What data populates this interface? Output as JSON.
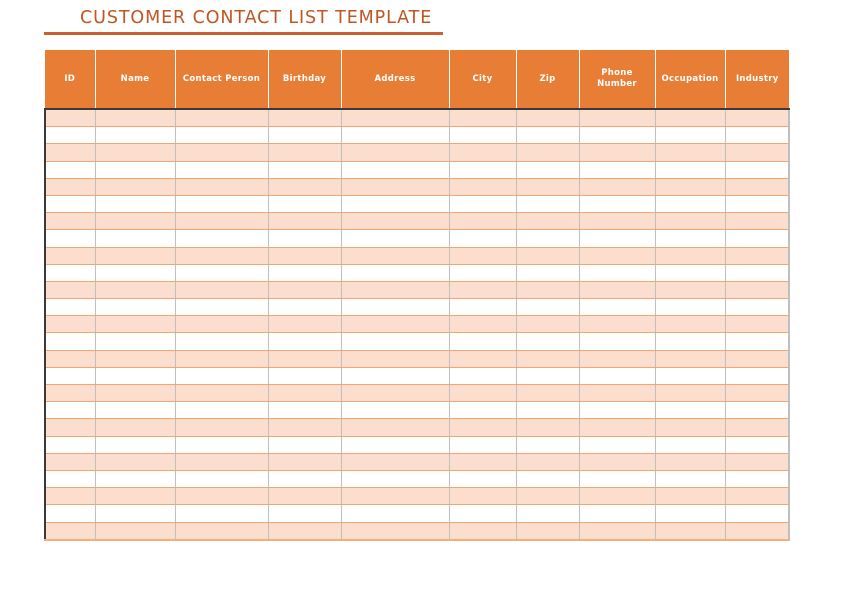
{
  "document": {
    "title": "CUSTOMER CONTACT LIST TEMPLATE"
  },
  "colors": {
    "title_text": "#C1551F",
    "title_rule": "#C86030",
    "header_background": "#E87D35",
    "header_text": "#FFFFFF",
    "row_stripe": "#FBDECE",
    "row_alternate": "#FFFFFF",
    "row_border": "#F0A673",
    "column_border": "#BFBFBF",
    "outer_border": "#3A3A3A",
    "page_background": "#FFFFFF"
  },
  "table": {
    "columns": [
      {
        "key": "id",
        "label": "ID"
      },
      {
        "key": "name",
        "label": "Name"
      },
      {
        "key": "contact",
        "label": "Contact Person"
      },
      {
        "key": "birthday",
        "label": "Birthday"
      },
      {
        "key": "address",
        "label": "Address"
      },
      {
        "key": "city",
        "label": "City"
      },
      {
        "key": "zip",
        "label": "Zip"
      },
      {
        "key": "phone",
        "label": "Phone Number"
      },
      {
        "key": "occupation",
        "label": "Occupation"
      },
      {
        "key": "industry",
        "label": "Industry"
      }
    ],
    "row_count": 25,
    "rows": [
      [
        "",
        "",
        "",
        "",
        "",
        "",
        "",
        "",
        "",
        ""
      ],
      [
        "",
        "",
        "",
        "",
        "",
        "",
        "",
        "",
        "",
        ""
      ],
      [
        "",
        "",
        "",
        "",
        "",
        "",
        "",
        "",
        "",
        ""
      ],
      [
        "",
        "",
        "",
        "",
        "",
        "",
        "",
        "",
        "",
        ""
      ],
      [
        "",
        "",
        "",
        "",
        "",
        "",
        "",
        "",
        "",
        ""
      ],
      [
        "",
        "",
        "",
        "",
        "",
        "",
        "",
        "",
        "",
        ""
      ],
      [
        "",
        "",
        "",
        "",
        "",
        "",
        "",
        "",
        "",
        ""
      ],
      [
        "",
        "",
        "",
        "",
        "",
        "",
        "",
        "",
        "",
        ""
      ],
      [
        "",
        "",
        "",
        "",
        "",
        "",
        "",
        "",
        "",
        ""
      ],
      [
        "",
        "",
        "",
        "",
        "",
        "",
        "",
        "",
        "",
        ""
      ],
      [
        "",
        "",
        "",
        "",
        "",
        "",
        "",
        "",
        "",
        ""
      ],
      [
        "",
        "",
        "",
        "",
        "",
        "",
        "",
        "",
        "",
        ""
      ],
      [
        "",
        "",
        "",
        "",
        "",
        "",
        "",
        "",
        "",
        ""
      ],
      [
        "",
        "",
        "",
        "",
        "",
        "",
        "",
        "",
        "",
        ""
      ],
      [
        "",
        "",
        "",
        "",
        "",
        "",
        "",
        "",
        "",
        ""
      ],
      [
        "",
        "",
        "",
        "",
        "",
        "",
        "",
        "",
        "",
        ""
      ],
      [
        "",
        "",
        "",
        "",
        "",
        "",
        "",
        "",
        "",
        ""
      ],
      [
        "",
        "",
        "",
        "",
        "",
        "",
        "",
        "",
        "",
        ""
      ],
      [
        "",
        "",
        "",
        "",
        "",
        "",
        "",
        "",
        "",
        ""
      ],
      [
        "",
        "",
        "",
        "",
        "",
        "",
        "",
        "",
        "",
        ""
      ],
      [
        "",
        "",
        "",
        "",
        "",
        "",
        "",
        "",
        "",
        ""
      ],
      [
        "",
        "",
        "",
        "",
        "",
        "",
        "",
        "",
        "",
        ""
      ],
      [
        "",
        "",
        "",
        "",
        "",
        "",
        "",
        "",
        "",
        ""
      ],
      [
        "",
        "",
        "",
        "",
        "",
        "",
        "",
        "",
        "",
        ""
      ],
      [
        "",
        "",
        "",
        "",
        "",
        "",
        "",
        "",
        "",
        ""
      ]
    ]
  }
}
